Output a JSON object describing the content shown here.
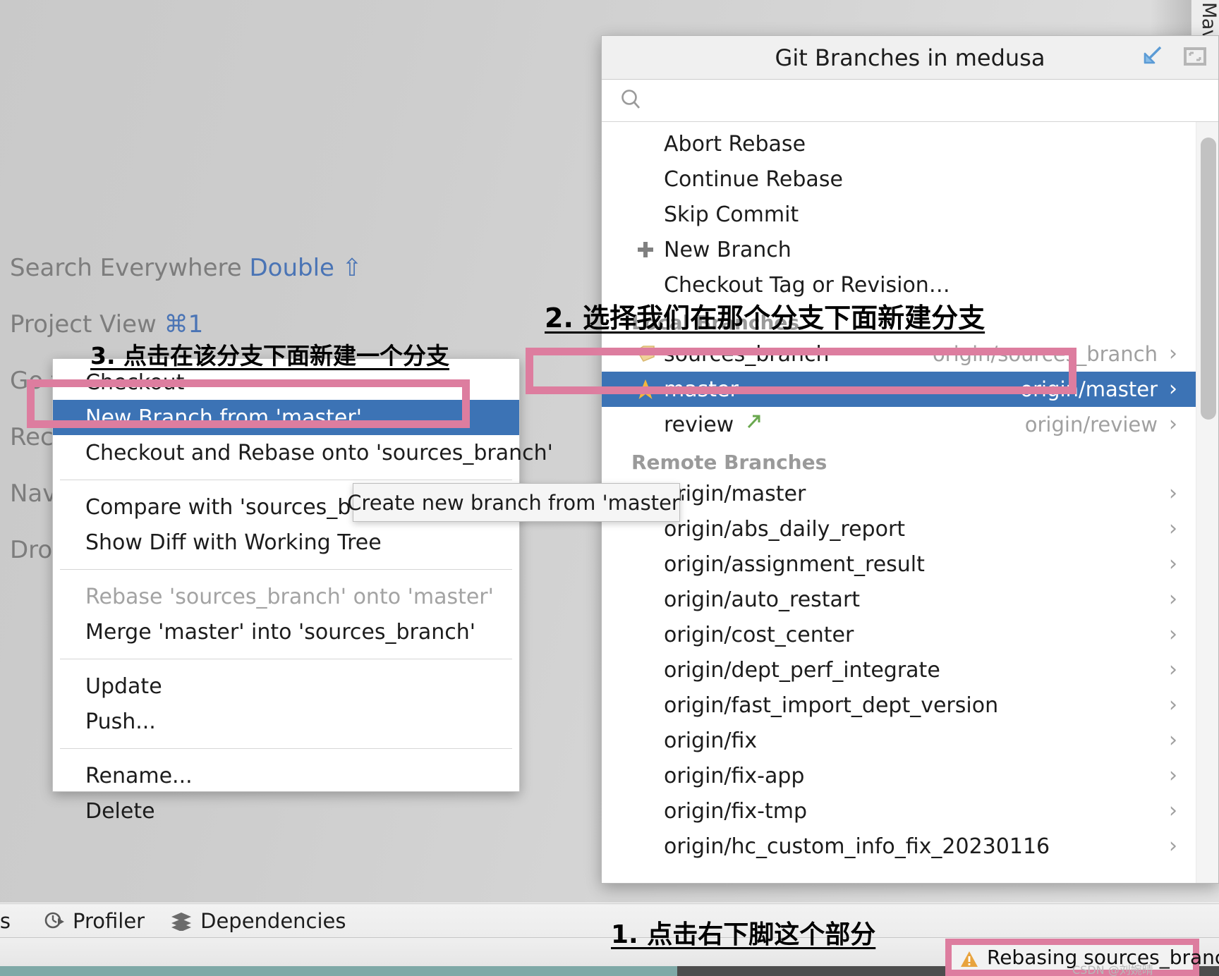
{
  "ide": {
    "maven_tab_label": "Maven",
    "hints": [
      {
        "label": "Search Everywhere",
        "key": "Double",
        "glyph": "⇧"
      },
      {
        "label": "Project View",
        "key": "⌘1",
        "glyph": ""
      },
      {
        "label": "Go t",
        "key": "",
        "glyph": ""
      },
      {
        "label": "Rec",
        "key": "",
        "glyph": ""
      },
      {
        "label": "Nav",
        "key": "",
        "glyph": ""
      },
      {
        "label": "Dro",
        "key": "",
        "glyph": ""
      }
    ],
    "toolwindows": [
      {
        "label": "es",
        "icon": ""
      },
      {
        "label": "Profiler",
        "icon": "profiler-icon"
      },
      {
        "label": "Dependencies",
        "icon": "dependencies-icon"
      }
    ]
  },
  "context_menu": {
    "items": [
      {
        "label": "Checkout",
        "state": "normal"
      },
      {
        "label": "New Branch from 'master'...",
        "state": "selected"
      },
      {
        "label": "Checkout and Rebase onto 'sources_branch'",
        "state": "normal"
      },
      {
        "label": "sep",
        "state": "separator"
      },
      {
        "label": "Compare with 'sources_branch'",
        "state": "normal"
      },
      {
        "label": "Show Diff with Working Tree",
        "state": "normal"
      },
      {
        "label": "sep",
        "state": "separator"
      },
      {
        "label": "Rebase 'sources_branch' onto 'master'",
        "state": "disabled"
      },
      {
        "label": "Merge 'master' into 'sources_branch'",
        "state": "normal"
      },
      {
        "label": "sep",
        "state": "separator"
      },
      {
        "label": "Update",
        "state": "normal"
      },
      {
        "label": "Push...",
        "state": "normal"
      },
      {
        "label": "sep",
        "state": "separator"
      },
      {
        "label": "Rename...",
        "state": "normal"
      },
      {
        "label": "Delete",
        "state": "normal"
      }
    ],
    "tooltip": "Create new branch from 'master'"
  },
  "popup": {
    "title": "Git Branches in medusa",
    "actions": [
      {
        "name": "pin-icon",
        "color": "#5b9bd5"
      },
      {
        "name": "restore-window-icon",
        "color": "#b6b6b6"
      }
    ],
    "search": {
      "value": "",
      "placeholder": ""
    },
    "actions_list": [
      {
        "label": "Abort Rebase",
        "icon": ""
      },
      {
        "label": "Continue Rebase",
        "icon": ""
      },
      {
        "label": "Skip Commit",
        "icon": ""
      },
      {
        "label": "New Branch",
        "icon": "plus-icon"
      },
      {
        "label": "Checkout Tag or Revision…",
        "icon": ""
      }
    ],
    "local_header": "Local Branches",
    "local_branches": [
      {
        "name": "sources_branch",
        "tracking": "origin/sources_branch",
        "icon": "tag-icon",
        "selected": false
      },
      {
        "name": "master",
        "tracking": "origin/master",
        "icon": "star-icon",
        "selected": true
      },
      {
        "name": "review",
        "tracking": "origin/review",
        "icon": "arrow-up-right-icon",
        "selected": false
      }
    ],
    "remote_header": "Remote Branches",
    "remote_branches": [
      {
        "name": "origin/master"
      },
      {
        "name": "origin/abs_daily_report"
      },
      {
        "name": "origin/assignment_result"
      },
      {
        "name": "origin/auto_restart"
      },
      {
        "name": "origin/cost_center"
      },
      {
        "name": "origin/dept_perf_integrate"
      },
      {
        "name": "origin/fast_import_dept_version"
      },
      {
        "name": "origin/fix"
      },
      {
        "name": "origin/fix-app"
      },
      {
        "name": "origin/fix-tmp"
      },
      {
        "name": "origin/hc_custom_info_fix_20230116"
      }
    ],
    "chevron": "›"
  },
  "annotations": {
    "step1": "1. 点击右下脚这个部分",
    "step2": "2. 选择我们在那个分支下面新建分支",
    "step3": "3. 点击在该分支下面新建一个分支",
    "highlight_color": "#dd7d9f"
  },
  "status": {
    "message": "Rebasing sources_branch",
    "icon": "warning-triangle-icon",
    "watermark": "CSDN @刘婉晴"
  }
}
